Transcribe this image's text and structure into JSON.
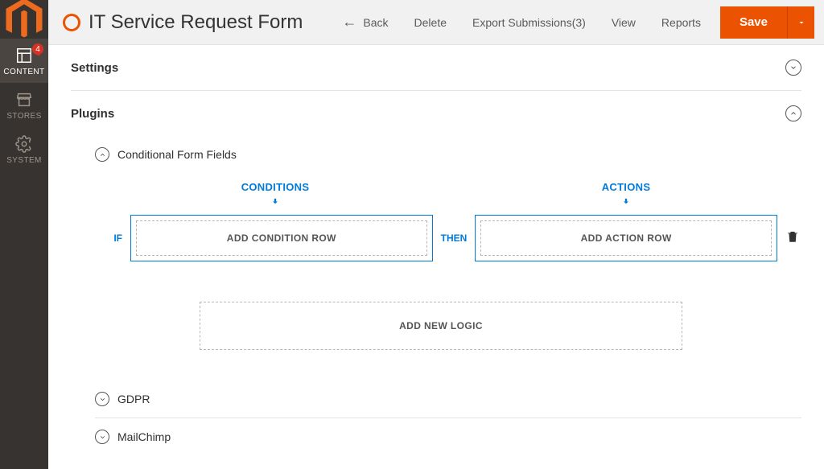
{
  "nav": {
    "items": [
      {
        "id": "content",
        "label": "CONTENT",
        "badge": "4"
      },
      {
        "id": "stores",
        "label": "STORES"
      },
      {
        "id": "system",
        "label": "SYSTEM"
      }
    ]
  },
  "header": {
    "title": "IT Service Request Form",
    "actions": {
      "back": "Back",
      "delete": "Delete",
      "export": "Export Submissions(3)",
      "view": "View",
      "reports": "Reports",
      "save": "Save"
    }
  },
  "sections": {
    "settings": {
      "title": "Settings",
      "expanded": false
    },
    "plugins": {
      "title": "Plugins",
      "expanded": true
    }
  },
  "plugins": {
    "conditional": {
      "title": "Conditional Form Fields",
      "expanded": true,
      "builder": {
        "conditions_header": "CONDITIONS",
        "actions_header": "ACTIONS",
        "if_label": "IF",
        "then_label": "THEN",
        "add_condition_row": "ADD CONDITION ROW",
        "add_action_row": "ADD ACTION ROW",
        "add_new_logic": "ADD NEW LOGIC"
      }
    },
    "gdpr": {
      "title": "GDPR",
      "expanded": false
    },
    "mailchimp": {
      "title": "MailChimp",
      "expanded": false
    }
  },
  "colors": {
    "accent_orange": "#eb5202",
    "accent_blue": "#007bdb",
    "nav_bg": "#373330"
  }
}
